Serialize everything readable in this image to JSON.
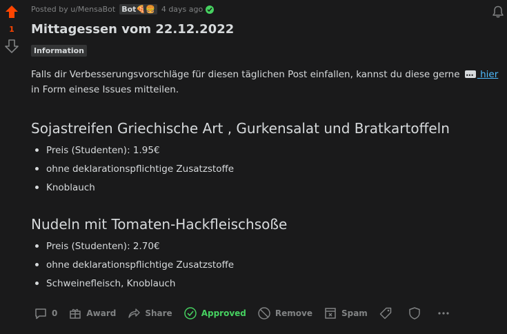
{
  "vote": {
    "score": "1"
  },
  "post": {
    "author": "Posted by u/MensaBot",
    "bot_flair": "Bot🍕🍔",
    "time": "4 days ago",
    "title": "Mittagessen vom 22.12.2022",
    "flair": "Information",
    "intro_before": "Falls dir Verbesserungsvorschläge für diesen täglichen Post einfallen, kannst du diese gerne",
    "intro_link": " hier",
    "intro_after": " in Form einese Issues mitteilen."
  },
  "meals": [
    {
      "title": "Sojastreifen Griechische Art , Gurkensalat und Bratkartoffeln",
      "details": [
        "Preis (Studenten): 1.95€",
        "ohne deklarationspflichtige Zusatzstoffe",
        "Knoblauch"
      ]
    },
    {
      "title": "Nudeln mit Tomaten-Hackfleischsoße",
      "details": [
        "Preis (Studenten): 2.70€",
        "ohne deklarationspflichtige Zusatzstoffe",
        "Schweinefleisch, Knoblauch"
      ]
    }
  ],
  "actions": {
    "comments": "0",
    "award": "Award",
    "share": "Share",
    "approved": "Approved",
    "remove": "Remove",
    "spam": "Spam"
  },
  "colors": {
    "upvote": "#ff4500",
    "link": "#4fbcff",
    "approved": "#46d160",
    "background": "#1a1a1b"
  }
}
